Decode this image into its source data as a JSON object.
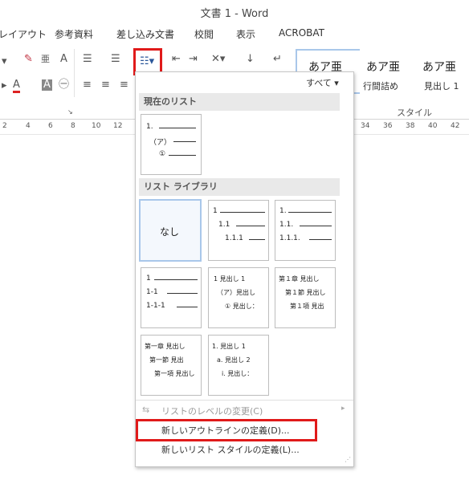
{
  "window": {
    "title": "文書 1 - Word"
  },
  "ribbon_tabs": [
    "レイアウト",
    "参考資料",
    "差し込み文書",
    "校閲",
    "表示",
    "ACROBAT"
  ],
  "styles": {
    "gallery": [
      {
        "preview": "あア亜",
        "label": ""
      },
      {
        "preview": "あア亜",
        "label": "行間詰め"
      },
      {
        "preview": "あア亜",
        "label": "見出し 1"
      }
    ],
    "group_label": "スタイル",
    "filter_label": "すべて"
  },
  "ruler": [
    "2",
    "4",
    "6",
    "8",
    "10",
    "12",
    "34",
    "36",
    "38",
    "40",
    "42"
  ],
  "menu": {
    "current_list_header": "現在のリスト",
    "current_list": [
      "1.",
      "（ア）",
      "①"
    ],
    "library_header": "リスト ライブラリ",
    "tiles": [
      {
        "id": "none",
        "label": "なし",
        "lines": []
      },
      {
        "id": "numeric-dot",
        "lines": [
          "1",
          "1.1",
          "1.1.1"
        ]
      },
      {
        "id": "numeric-dot-trailing",
        "lines": [
          "1.",
          "1.1.",
          "1.1.1."
        ]
      },
      {
        "id": "hyphen",
        "lines": [
          "1",
          "1-1",
          "1-1-1"
        ]
      },
      {
        "id": "heading-mixed",
        "lines": [
          "1 見出し 1",
          "（ア）見出し",
          "① 見出し："
        ]
      },
      {
        "id": "chapter-section",
        "lines": [
          "第１章 見出し",
          "第１節 見出し",
          "第１項 見出"
        ]
      },
      {
        "id": "chapter-section-2",
        "lines": [
          "第一章 見出し",
          "第一節 見出",
          "第一項 見出し"
        ]
      },
      {
        "id": "heading-alpha",
        "lines": [
          "1. 見出し 1",
          "a. 見出し 2",
          "i. 見出し："
        ]
      }
    ],
    "items": {
      "change_level": "リストのレベルの変更(C)",
      "new_outline": "新しいアウトラインの定義(D)...",
      "new_list_style": "新しいリスト スタイルの定義(L)..."
    }
  }
}
